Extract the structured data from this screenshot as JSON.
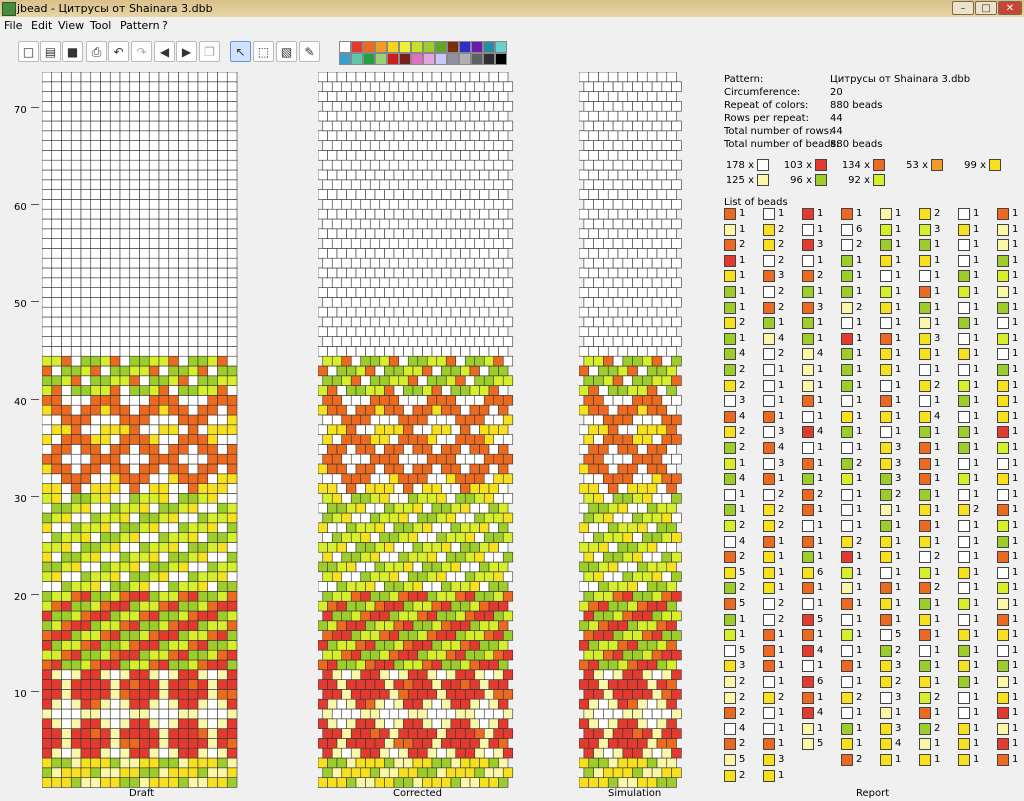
{
  "window": {
    "title": "jbead - Цитрусы от Shainara 3.dbb",
    "minimize": "–",
    "maximize": "□",
    "close": "✕"
  },
  "menu": [
    "File",
    "Edit",
    "View",
    "Tool",
    "Pattern",
    "?"
  ],
  "toolbar": {
    "buttons": [
      {
        "name": "new-icon",
        "glyph": "□"
      },
      {
        "name": "open-icon",
        "glyph": "▤"
      },
      {
        "name": "save-icon",
        "glyph": "■"
      },
      {
        "name": "print-icon",
        "glyph": "⎙"
      },
      {
        "name": "undo-icon",
        "glyph": "↶"
      },
      {
        "name": "redo-icon",
        "glyph": "↷"
      },
      {
        "name": "arrow-left-icon",
        "glyph": "◀"
      },
      {
        "name": "arrow-right-icon",
        "glyph": "▶"
      },
      {
        "name": "copy-icon",
        "glyph": "❐"
      },
      {
        "name": "pointer-icon",
        "glyph": "↖"
      },
      {
        "name": "select-rect-icon",
        "glyph": "⬚"
      },
      {
        "name": "fill-icon",
        "glyph": "▧"
      },
      {
        "name": "eyedropper-icon",
        "glyph": "✎"
      }
    ]
  },
  "palette": [
    "#ffffff",
    "#e23a2f",
    "#ec6a1f",
    "#f59a26",
    "#f7d31a",
    "#f2ef3a",
    "#c4e22a",
    "#9ccd2a",
    "#5fa52a",
    "#7a2d0f",
    "#3030c8",
    "#6a1ab0",
    "#2a8ca0",
    "#6acfcf",
    "#3a9fcf",
    "#5ec7a8",
    "#20a040",
    "#9ad07a",
    "#c81e1e",
    "#7a1e1e",
    "#e070c0",
    "#e8a2e0",
    "#c8c8ff",
    "#9090a0",
    "#b0b0b0",
    "#606060",
    "#303030",
    "#000000"
  ],
  "colors": {
    "W": "#ffffff",
    "R": "#e23a2f",
    "O": "#ec6a1f",
    "A": "#f59a26",
    "Y": "#f7e01e",
    "P": "#fbf7a8",
    "G": "#9ccd2a",
    "L": "#d6ef2a"
  },
  "axis": {
    "labels": [
      "70",
      "60",
      "50",
      "40",
      "30",
      "20",
      "10"
    ]
  },
  "panels": {
    "draft": "Draft",
    "corrected": "Corrected",
    "simulation": "Simulation",
    "report": "Report"
  },
  "report": {
    "pattern_label": "Pattern:",
    "pattern": "Цитрусы от Shainara 3.dbb",
    "circ_label": "Circumference:",
    "circumference": "20",
    "repeat_label": "Repeat of colors:",
    "repeat": "880 beads",
    "rows_repeat_label": "Rows per repeat:",
    "rows_repeat": "44",
    "total_rows_label": "Total number of rows:",
    "total_rows": "44",
    "total_beads_label": "Total number of beads:",
    "total_beads": "880 beads",
    "counts": [
      {
        "label": "178 x",
        "color": "W"
      },
      {
        "label": "103 x",
        "color": "R"
      },
      {
        "label": "134 x",
        "color": "O"
      },
      {
        "label": "53 x",
        "color": "A"
      },
      {
        "label": "99 x",
        "color": "Y"
      },
      {
        "label": "125 x",
        "color": "P"
      },
      {
        "label": "96 x",
        "color": "G"
      },
      {
        "label": "92 x",
        "color": "L"
      }
    ],
    "list_label": "List of beads",
    "bead_list": [
      [
        [
          "O",
          "1"
        ],
        [
          "P",
          "1"
        ],
        [
          "O",
          "2"
        ],
        [
          "R",
          "1"
        ],
        [
          "Y",
          "1"
        ],
        [
          "G",
          "1"
        ],
        [
          "G",
          "1"
        ],
        [
          "Y",
          "2"
        ],
        [
          "G",
          "1"
        ],
        [
          "G",
          "4"
        ],
        [
          "G",
          "2"
        ],
        [
          "Y",
          "2"
        ],
        [
          "W",
          "3"
        ],
        [
          "O",
          "4"
        ],
        [
          "Y",
          "2"
        ],
        [
          "G",
          "2"
        ],
        [
          "L",
          "1"
        ],
        [
          "G",
          "4"
        ],
        [
          "W",
          "1"
        ],
        [
          "G",
          "1"
        ],
        [
          "L",
          "2"
        ],
        [
          "W",
          "4"
        ],
        [
          "O",
          "2"
        ],
        [
          "Y",
          "5"
        ],
        [
          "G",
          "2"
        ],
        [
          "O",
          "5"
        ],
        [
          "G",
          "1"
        ],
        [
          "L",
          "1"
        ],
        [
          "W",
          "5"
        ],
        [
          "Y",
          "3"
        ],
        [
          "P",
          "2"
        ],
        [
          "P",
          "2"
        ],
        [
          "O",
          "2"
        ],
        [
          "W",
          "4"
        ],
        [
          "O",
          "2"
        ],
        [
          "P",
          "5"
        ],
        [
          "Y",
          "2"
        ]
      ],
      [
        [
          "W",
          "1"
        ],
        [
          "Y",
          "2"
        ],
        [
          "Y",
          "2"
        ],
        [
          "W",
          "2"
        ],
        [
          "O",
          "3"
        ],
        [
          "W",
          "2"
        ],
        [
          "O",
          "2"
        ],
        [
          "G",
          "1"
        ],
        [
          "P",
          "4"
        ],
        [
          "W",
          "2"
        ],
        [
          "W",
          "1"
        ],
        [
          "W",
          "1"
        ],
        [
          "W",
          "1"
        ],
        [
          "O",
          "1"
        ],
        [
          "W",
          "3"
        ],
        [
          "O",
          "4"
        ],
        [
          "W",
          "3"
        ],
        [
          "O",
          "1"
        ],
        [
          "W",
          "2"
        ],
        [
          "Y",
          "2"
        ],
        [
          "Y",
          "2"
        ],
        [
          "O",
          "1"
        ],
        [
          "Y",
          "1"
        ],
        [
          "Y",
          "1"
        ],
        [
          "Y",
          "1"
        ],
        [
          "W",
          "2"
        ],
        [
          "W",
          "2"
        ],
        [
          "O",
          "1"
        ],
        [
          "O",
          "1"
        ],
        [
          "O",
          "1"
        ],
        [
          "W",
          "1"
        ],
        [
          "Y",
          "2"
        ],
        [
          "W",
          "1"
        ],
        [
          "W",
          "1"
        ],
        [
          "O",
          "1"
        ],
        [
          "Y",
          "3"
        ],
        [
          "Y",
          "1"
        ]
      ],
      [
        [
          "R",
          "1"
        ],
        [
          "W",
          "1"
        ],
        [
          "R",
          "3"
        ],
        [
          "W",
          "1"
        ],
        [
          "O",
          "2"
        ],
        [
          "G",
          "1"
        ],
        [
          "O",
          "3"
        ],
        [
          "G",
          "1"
        ],
        [
          "G",
          "1"
        ],
        [
          "P",
          "4"
        ],
        [
          "P",
          "1"
        ],
        [
          "P",
          "1"
        ],
        [
          "O",
          "1"
        ],
        [
          "W",
          "1"
        ],
        [
          "R",
          "4"
        ],
        [
          "W",
          "1"
        ],
        [
          "O",
          "1"
        ],
        [
          "G",
          "1"
        ],
        [
          "O",
          "2"
        ],
        [
          "O",
          "1"
        ],
        [
          "W",
          "1"
        ],
        [
          "O",
          "1"
        ],
        [
          "G",
          "1"
        ],
        [
          "Y",
          "6"
        ],
        [
          "O",
          "1"
        ],
        [
          "W",
          "1"
        ],
        [
          "R",
          "5"
        ],
        [
          "O",
          "1"
        ],
        [
          "R",
          "4"
        ],
        [
          "W",
          "1"
        ],
        [
          "R",
          "6"
        ],
        [
          "O",
          "1"
        ],
        [
          "R",
          "4"
        ],
        [
          "P",
          "1"
        ],
        [
          "P",
          "5"
        ]
      ],
      [
        [
          "O",
          "1"
        ],
        [
          "W",
          "6"
        ],
        [
          "W",
          "2"
        ],
        [
          "G",
          "1"
        ],
        [
          "G",
          "1"
        ],
        [
          "G",
          "1"
        ],
        [
          "P",
          "2"
        ],
        [
          "W",
          "1"
        ],
        [
          "R",
          "1"
        ],
        [
          "G",
          "1"
        ],
        [
          "G",
          "1"
        ],
        [
          "G",
          "1"
        ],
        [
          "W",
          "1"
        ],
        [
          "Y",
          "1"
        ],
        [
          "G",
          "1"
        ],
        [
          "W",
          "1"
        ],
        [
          "G",
          "2"
        ],
        [
          "L",
          "1"
        ],
        [
          "W",
          "1"
        ],
        [
          "W",
          "1"
        ],
        [
          "W",
          "1"
        ],
        [
          "Y",
          "2"
        ],
        [
          "R",
          "1"
        ],
        [
          "L",
          "1"
        ],
        [
          "P",
          "1"
        ],
        [
          "O",
          "1"
        ],
        [
          "W",
          "1"
        ],
        [
          "L",
          "1"
        ],
        [
          "W",
          "1"
        ],
        [
          "O",
          "1"
        ],
        [
          "W",
          "1"
        ],
        [
          "Y",
          "2"
        ],
        [
          "W",
          "1"
        ],
        [
          "G",
          "1"
        ],
        [
          "Y",
          "1"
        ],
        [
          "O",
          "2"
        ]
      ],
      [
        [
          "P",
          "1"
        ],
        [
          "L",
          "1"
        ],
        [
          "G",
          "1"
        ],
        [
          "Y",
          "1"
        ],
        [
          "W",
          "1"
        ],
        [
          "L",
          "1"
        ],
        [
          "Y",
          "1"
        ],
        [
          "W",
          "1"
        ],
        [
          "O",
          "1"
        ],
        [
          "Y",
          "1"
        ],
        [
          "Y",
          "1"
        ],
        [
          "W",
          "1"
        ],
        [
          "O",
          "1"
        ],
        [
          "Y",
          "1"
        ],
        [
          "W",
          "1"
        ],
        [
          "Y",
          "3"
        ],
        [
          "Y",
          "3"
        ],
        [
          "G",
          "3"
        ],
        [
          "G",
          "2"
        ],
        [
          "P",
          "1"
        ],
        [
          "G",
          "1"
        ],
        [
          "Y",
          "1"
        ],
        [
          "Y",
          "1"
        ],
        [
          "W",
          "1"
        ],
        [
          "O",
          "1"
        ],
        [
          "Y",
          "1"
        ],
        [
          "O",
          "1"
        ],
        [
          "W",
          "5"
        ],
        [
          "G",
          "2"
        ],
        [
          "Y",
          "3"
        ],
        [
          "Y",
          "2"
        ],
        [
          "W",
          "3"
        ],
        [
          "P",
          "1"
        ],
        [
          "Y",
          "3"
        ],
        [
          "Y",
          "4"
        ],
        [
          "Y",
          "1"
        ]
      ],
      [
        [
          "Y",
          "2"
        ],
        [
          "L",
          "3"
        ],
        [
          "G",
          "1"
        ],
        [
          "Y",
          "1"
        ],
        [
          "W",
          "1"
        ],
        [
          "O",
          "1"
        ],
        [
          "G",
          "1"
        ],
        [
          "P",
          "1"
        ],
        [
          "Y",
          "3"
        ],
        [
          "Y",
          "1"
        ],
        [
          "W",
          "1"
        ],
        [
          "Y",
          "2"
        ],
        [
          "W",
          "1"
        ],
        [
          "Y",
          "4"
        ],
        [
          "G",
          "1"
        ],
        [
          "O",
          "1"
        ],
        [
          "O",
          "1"
        ],
        [
          "O",
          "1"
        ],
        [
          "G",
          "1"
        ],
        [
          "Y",
          "1"
        ],
        [
          "O",
          "1"
        ],
        [
          "Y",
          "1"
        ],
        [
          "W",
          "2"
        ],
        [
          "L",
          "1"
        ],
        [
          "O",
          "2"
        ],
        [
          "G",
          "1"
        ],
        [
          "Y",
          "1"
        ],
        [
          "O",
          "1"
        ],
        [
          "W",
          "1"
        ],
        [
          "G",
          "1"
        ],
        [
          "Y",
          "1"
        ],
        [
          "L",
          "2"
        ],
        [
          "O",
          "1"
        ],
        [
          "G",
          "2"
        ],
        [
          "P",
          "1"
        ],
        [
          "Y",
          "1"
        ]
      ],
      [
        [
          "W",
          "1"
        ],
        [
          "Y",
          "1"
        ],
        [
          "W",
          "1"
        ],
        [
          "W",
          "1"
        ],
        [
          "G",
          "1"
        ],
        [
          "L",
          "1"
        ],
        [
          "W",
          "1"
        ],
        [
          "G",
          "1"
        ],
        [
          "W",
          "1"
        ],
        [
          "Y",
          "1"
        ],
        [
          "W",
          "1"
        ],
        [
          "L",
          "1"
        ],
        [
          "G",
          "1"
        ],
        [
          "W",
          "1"
        ],
        [
          "G",
          "1"
        ],
        [
          "G",
          "1"
        ],
        [
          "W",
          "1"
        ],
        [
          "L",
          "1"
        ],
        [
          "W",
          "1"
        ],
        [
          "Y",
          "2"
        ],
        [
          "W",
          "1"
        ],
        [
          "W",
          "1"
        ],
        [
          "W",
          "1"
        ],
        [
          "Y",
          "1"
        ],
        [
          "W",
          "1"
        ],
        [
          "L",
          "1"
        ],
        [
          "W",
          "1"
        ],
        [
          "Y",
          "1"
        ],
        [
          "G",
          "1"
        ],
        [
          "Y",
          "1"
        ],
        [
          "G",
          "1"
        ],
        [
          "W",
          "1"
        ],
        [
          "W",
          "1"
        ],
        [
          "Y",
          "1"
        ],
        [
          "Y",
          "1"
        ],
        [
          "Y",
          "1"
        ]
      ],
      [
        [
          "O",
          "1"
        ],
        [
          "P",
          "1"
        ],
        [
          "P",
          "1"
        ],
        [
          "G",
          "1"
        ],
        [
          "L",
          "1"
        ],
        [
          "P",
          "1"
        ],
        [
          "G",
          "1"
        ],
        [
          "W",
          "1"
        ],
        [
          "L",
          "1"
        ],
        [
          "W",
          "1"
        ],
        [
          "G",
          "1"
        ],
        [
          "Y",
          "1"
        ],
        [
          "Y",
          "1"
        ],
        [
          "Y",
          "1"
        ],
        [
          "R",
          "1"
        ],
        [
          "L",
          "1"
        ],
        [
          "W",
          "1"
        ],
        [
          "Y",
          "1"
        ],
        [
          "W",
          "1"
        ],
        [
          "O",
          "1"
        ],
        [
          "L",
          "1"
        ],
        [
          "G",
          "1"
        ],
        [
          "O",
          "1"
        ],
        [
          "W",
          "1"
        ],
        [
          "L",
          "1"
        ],
        [
          "P",
          "1"
        ],
        [
          "O",
          "1"
        ],
        [
          "Y",
          "1"
        ],
        [
          "W",
          "1"
        ],
        [
          "G",
          "1"
        ],
        [
          "P",
          "1"
        ],
        [
          "Y",
          "1"
        ],
        [
          "R",
          "1"
        ],
        [
          "P",
          "1"
        ],
        [
          "R",
          "1"
        ],
        [
          "O",
          "1"
        ]
      ]
    ]
  }
}
